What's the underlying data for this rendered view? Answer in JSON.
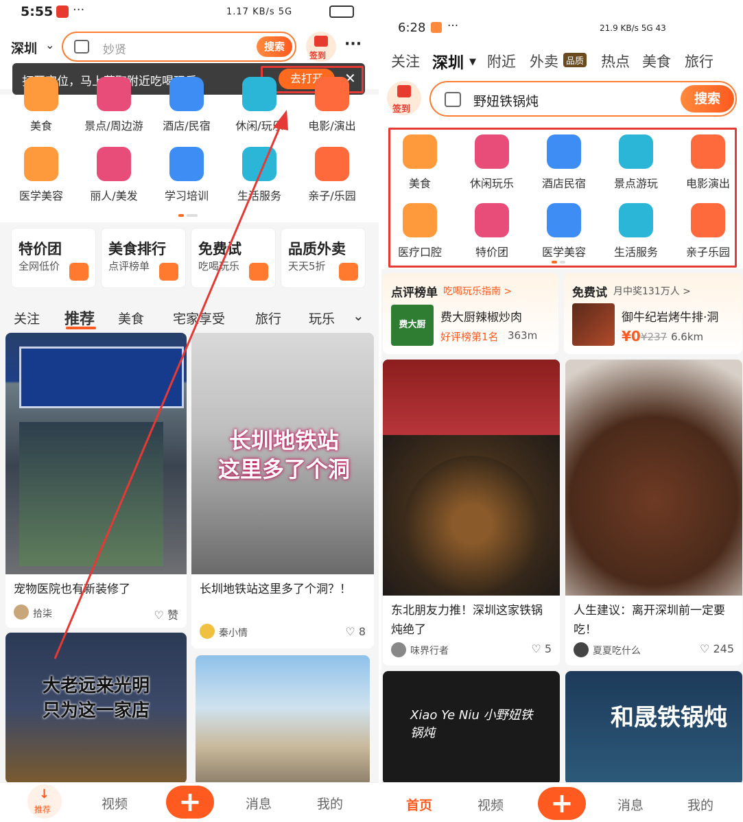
{
  "left": {
    "status": {
      "time": "5:55",
      "indicators": "1.17 KB/s  5G"
    },
    "city": "深圳",
    "search_placeholder": "妙贤",
    "search_button": "搜索",
    "signin": "签到",
    "toast": {
      "text": "打开定位，马上获取附近吃喝玩乐",
      "button": "去打开"
    },
    "categories_row1": [
      "美食",
      "景点/周边游",
      "酒店/民宿",
      "休闲/玩乐",
      "电影/演出"
    ],
    "categories_row2": [
      "医学美容",
      "丽人/美发",
      "学习培训",
      "生活服务",
      "亲子/乐园"
    ],
    "promos": [
      {
        "title": "特价团",
        "sub": "全网低价"
      },
      {
        "title": "美食排行",
        "sub": "点评榜单"
      },
      {
        "title": "免费试",
        "sub": "吃喝玩乐"
      },
      {
        "title": "品质外卖",
        "sub": "天天5折"
      }
    ],
    "feed_tabs": [
      "关注",
      "推荐",
      "美食",
      "宅家享受",
      "旅行",
      "玩乐"
    ],
    "cards": [
      {
        "title": "宠物医院也有新装修了",
        "author": "拾柒",
        "likes": "赞",
        "overlay": ""
      },
      {
        "title": "长圳地铁站这里多了个洞？！",
        "author": "秦小情",
        "likes": "8",
        "overlay": "长圳地铁站\n这里多了个洞"
      },
      {
        "title": "",
        "author": "",
        "likes": "",
        "overlay": "大老远来光明\n只为这一家店"
      }
    ],
    "bottom": {
      "home": "推荐",
      "video": "视频",
      "msg": "消息",
      "mine": "我的"
    }
  },
  "right": {
    "status": {
      "time": "6:28",
      "indicators": "21.9 KB/s  5G  43"
    },
    "top_tabs": [
      "关注",
      "深圳",
      "附近",
      "外卖",
      "热点",
      "美食",
      "旅行"
    ],
    "waimai_badge": "品质",
    "signin": "签到",
    "search_value": "野妞铁锅炖",
    "search_button": "搜索",
    "categories_row1": [
      "美食",
      "休闲玩乐",
      "酒店民宿",
      "景点游玩",
      "电影演出"
    ],
    "categories_row2": [
      "医疗口腔",
      "特价团",
      "医学美容",
      "生活服务",
      "亲子乐园"
    ],
    "rank": {
      "title": "点评榜单",
      "subtitle": "吃喝玩乐指南 >",
      "shop": "费大厨辣椒炒肉",
      "tag": "好评榜第1名",
      "distance": "363m",
      "logo": "费大厨"
    },
    "free": {
      "title": "免费试",
      "subtitle": "月中奖131万人 >",
      "shop": "御牛纪岩烤牛排·洞",
      "price": "¥0",
      "orig": "¥237",
      "distance": "6.6km"
    },
    "cards": [
      {
        "title": "东北朋友力推！深圳这家铁锅炖绝了",
        "author": "味界行者",
        "likes": "5"
      },
      {
        "title": "人生建议：离开深圳前一定要吃！",
        "author": "夏夏吃什么",
        "likes": "245"
      },
      {
        "overlay": "Xiao Ye Niu 小野妞铁锅炖"
      },
      {
        "overlay": "和晟铁锅炖"
      }
    ],
    "bottom": {
      "home": "首页",
      "video": "视频",
      "msg": "消息",
      "mine": "我的"
    }
  },
  "colors": {
    "accent": "#ff5a1f",
    "highlight": "#e53935"
  }
}
